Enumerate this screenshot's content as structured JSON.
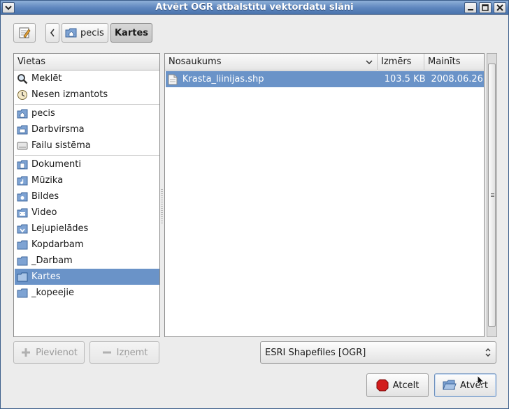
{
  "window": {
    "title": "Atvērt OGR atbalstītu vektordatu slāni"
  },
  "toolbar": {
    "breadcrumb": [
      {
        "label": "pecis",
        "icon": "home-folder-icon",
        "active": false
      },
      {
        "label": "Kartes",
        "icon": "",
        "active": true
      }
    ]
  },
  "places": {
    "header": "Vietas",
    "groups": [
      [
        {
          "label": "Meklēt",
          "icon": "search-icon"
        },
        {
          "label": "Nesen izmantots",
          "icon": "recent-icon"
        }
      ],
      [
        {
          "label": "pecis",
          "icon": "home-folder-icon"
        },
        {
          "label": "Darbvirsma",
          "icon": "desktop-folder-icon"
        },
        {
          "label": "Failu sistēma",
          "icon": "drive-icon"
        }
      ],
      [
        {
          "label": "Dokumenti",
          "icon": "documents-folder-icon"
        },
        {
          "label": "Mūzika",
          "icon": "music-folder-icon"
        },
        {
          "label": "Bildes",
          "icon": "pictures-folder-icon"
        },
        {
          "label": "Video",
          "icon": "video-folder-icon"
        },
        {
          "label": "Lejupielādes",
          "icon": "downloads-folder-icon"
        },
        {
          "label": "Kopdarbam",
          "icon": "folder-icon"
        },
        {
          "label": "_Darbam",
          "icon": "folder-icon"
        },
        {
          "label": "Kartes",
          "icon": "folder-icon",
          "selected": true
        },
        {
          "label": "_kopeejie",
          "icon": "folder-icon"
        }
      ]
    ]
  },
  "files": {
    "columns": {
      "name": "Nosaukums",
      "size": "Izmērs",
      "modified": "Mainīts"
    },
    "rows": [
      {
        "name": "Krasta_liinijas.shp",
        "size": "103.5 KB",
        "modified": "2008.06.26."
      }
    ]
  },
  "bottom": {
    "add_label": "Pievienot",
    "remove_label": "Izņemt",
    "filter_value": "ESRI Shapefiles [OGR]",
    "cancel_label": "Atcelt",
    "open_label": "Atvērt"
  },
  "colors": {
    "selection": "#6a93c8",
    "titlebar": "#5d85bd"
  }
}
